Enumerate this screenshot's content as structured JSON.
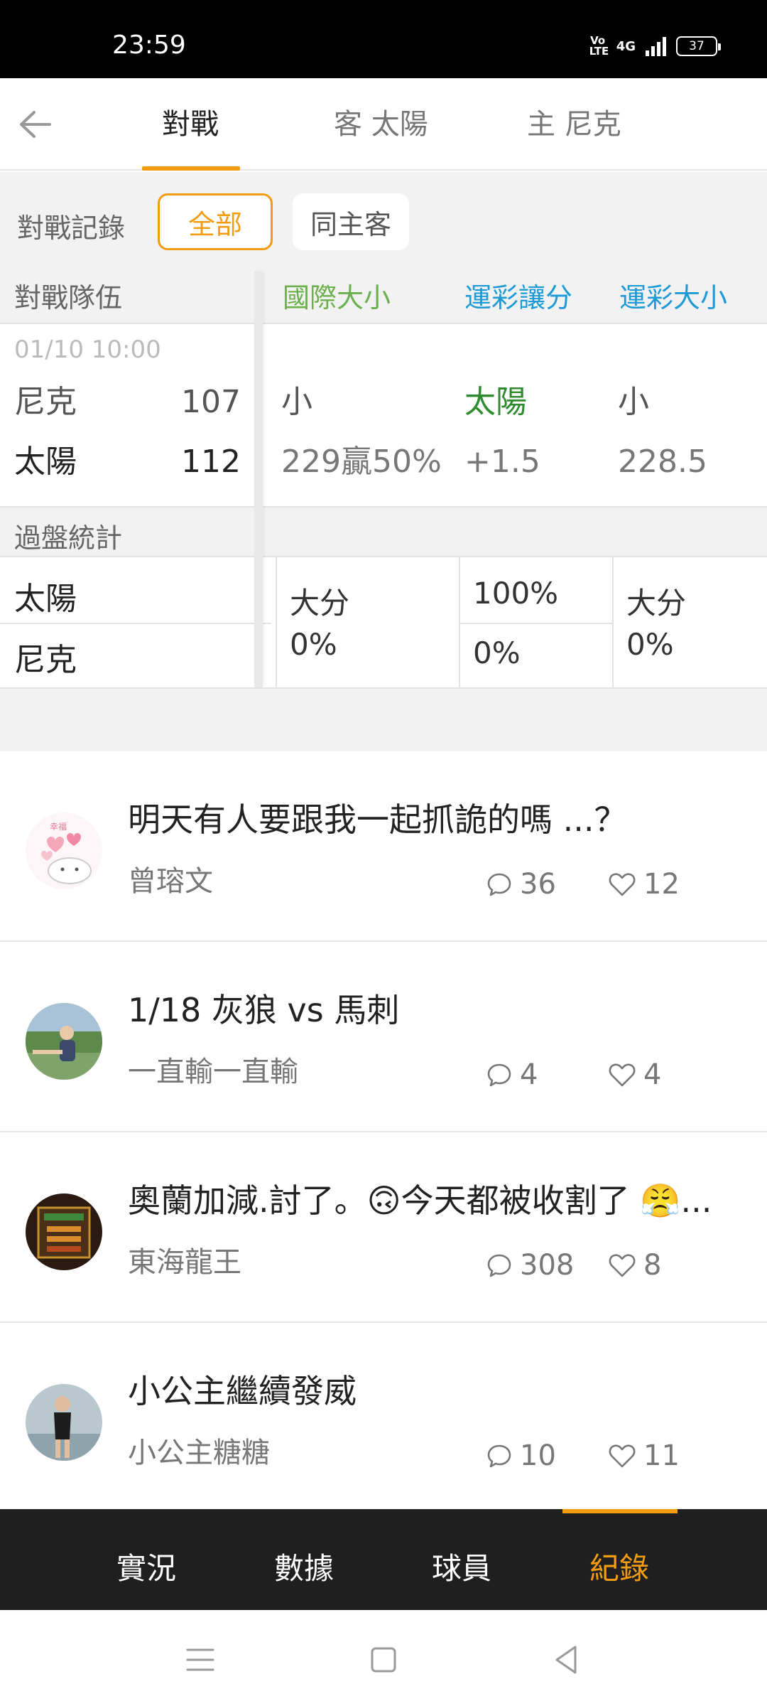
{
  "status_bar": {
    "time": "23:59",
    "volte": "Vo LTE",
    "network": "4G",
    "battery": "37"
  },
  "top_nav": {
    "tabs": [
      {
        "label": "對戰",
        "active": true
      },
      {
        "label": "客 太陽",
        "active": false
      },
      {
        "label": "主 尼克",
        "active": false
      }
    ]
  },
  "filter": {
    "label": "對戰記錄",
    "options": [
      {
        "label": "全部",
        "selected": true
      },
      {
        "label": "同主客",
        "selected": false
      }
    ]
  },
  "table": {
    "headers": {
      "teams": "對戰隊伍",
      "intl_total": "國際大小",
      "spread": "運彩讓分",
      "total": "運彩大小"
    },
    "match": {
      "date": "01/10 10:00",
      "rows": [
        {
          "team": "尼克",
          "score": "107",
          "intl_total": "小",
          "spread": "太陽",
          "total": "小"
        },
        {
          "team": "太陽",
          "score": "112",
          "intl_total": "229贏50%",
          "spread": "+1.5",
          "total": "228.5"
        }
      ]
    },
    "stats": {
      "label": "過盤統計",
      "teams": [
        "太陽",
        "尼克"
      ],
      "intl_total": {
        "line1": "大分",
        "line2": "0%"
      },
      "spread": {
        "row1": "100%",
        "row2": "0%"
      },
      "total": {
        "line1": "大分",
        "line2": "0%"
      }
    }
  },
  "posts": [
    {
      "title": "明天有人要跟我一起抓詭的嗎 ...？",
      "author": "曾瑢文",
      "comments": "36",
      "likes": "12",
      "avatar": "cartoon-cat-avatar"
    },
    {
      "title": "1/18 灰狼 vs 馬刺",
      "author": "一直輸一直輸",
      "comments": "4",
      "likes": "4",
      "avatar": "photo-avatar"
    },
    {
      "title": "奧蘭加減.討了。🙃今天都被收割了 😤...",
      "author": "東海龍王",
      "comments": "308",
      "likes": "8",
      "avatar": "photo-avatar"
    },
    {
      "title": "小公主繼續發威",
      "author": "小公主糖糖",
      "comments": "10",
      "likes": "11",
      "avatar": "photo-avatar"
    }
  ],
  "bottom_nav": {
    "tabs": [
      {
        "label": "實況",
        "active": false
      },
      {
        "label": "數據",
        "active": false
      },
      {
        "label": "球員",
        "active": false
      },
      {
        "label": "紀錄",
        "active": true
      }
    ]
  },
  "colors": {
    "accent": "#f39c12",
    "green": "#6ab04c",
    "blue": "#1e9ad6",
    "spread_team": "#2e8b2e"
  }
}
